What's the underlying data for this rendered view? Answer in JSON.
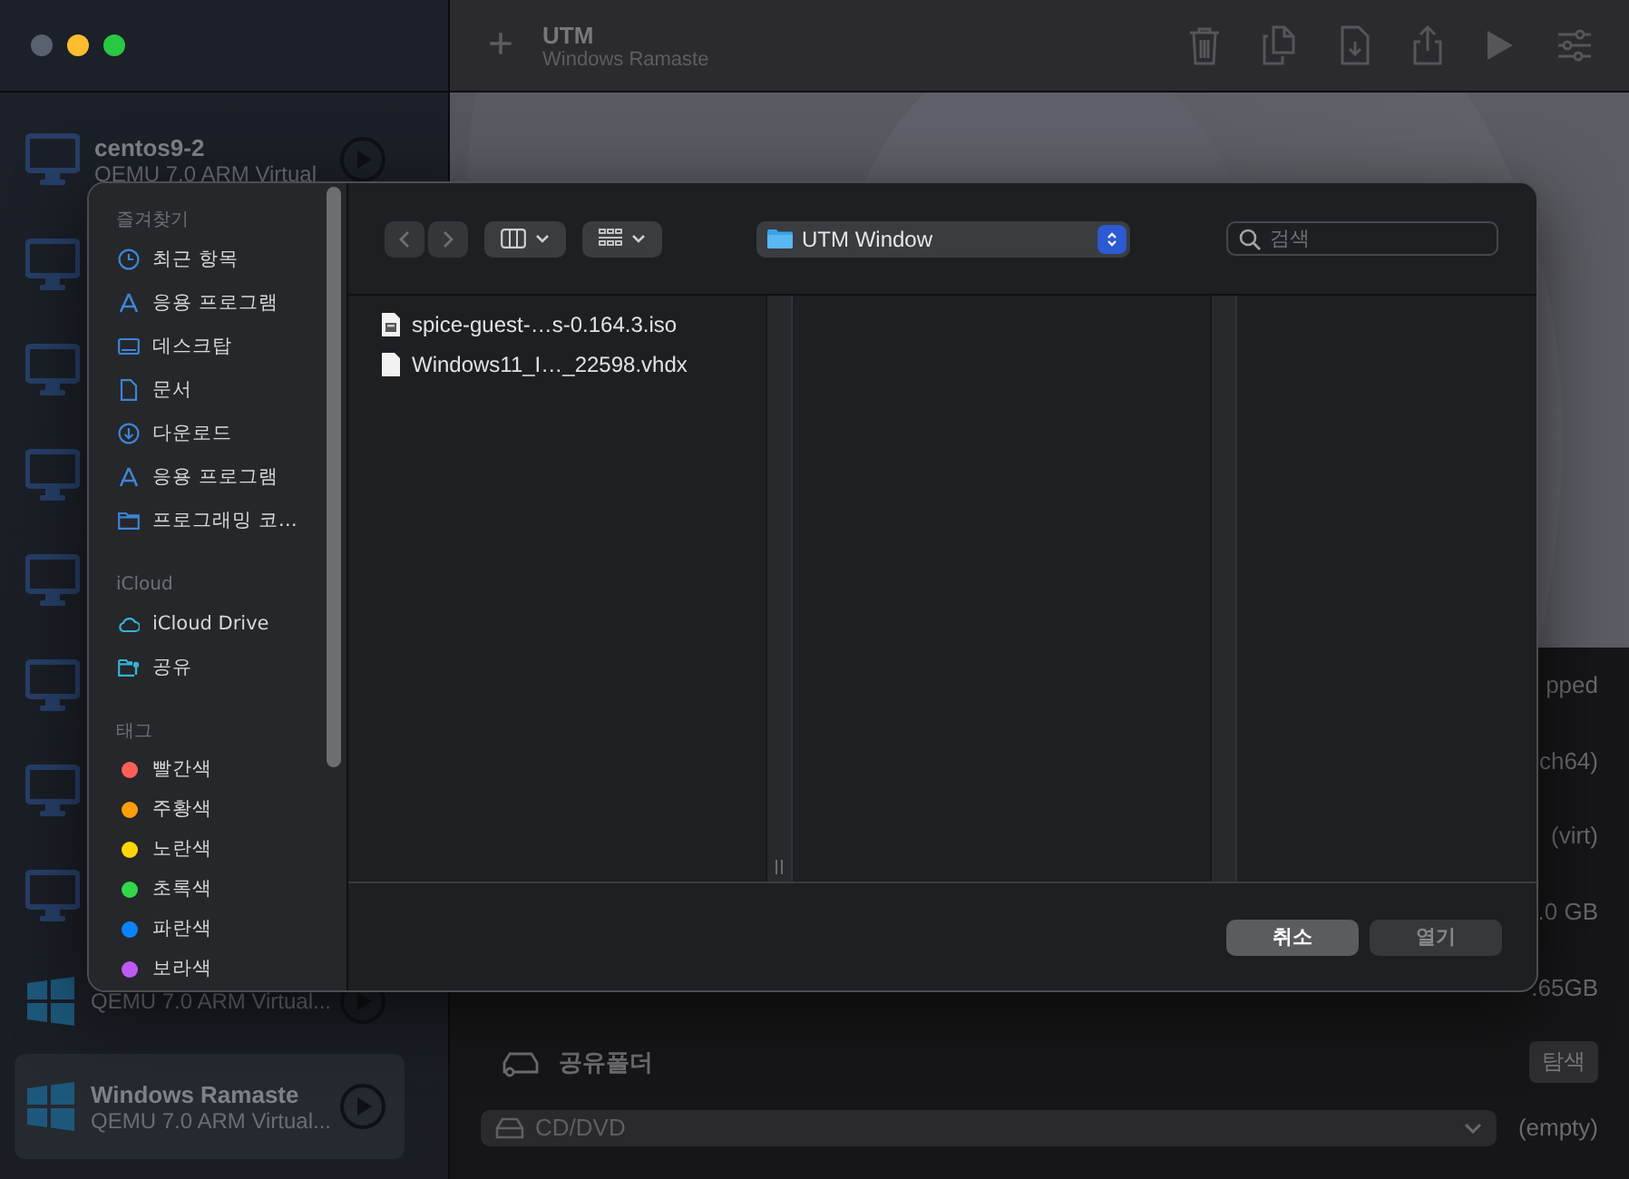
{
  "sidebar": {
    "vms": [
      {
        "name": "centos9-2",
        "subtitle": "QEMU 7.0 ARM Virtual",
        "kind": "monitor",
        "selected": false
      },
      {
        "kind": "monitor",
        "selected": false
      },
      {
        "kind": "monitor",
        "selected": false
      },
      {
        "kind": "monitor",
        "selected": false
      },
      {
        "kind": "monitor",
        "selected": false
      },
      {
        "kind": "monitor",
        "selected": false
      },
      {
        "kind": "monitor",
        "selected": false
      },
      {
        "kind": "monitor",
        "selected": false
      },
      {
        "subtitle": "QEMU 7.0 ARM Virtual...",
        "kind": "windows",
        "selected": false
      },
      {
        "name": "Windows Ramaste",
        "subtitle": "QEMU 7.0 ARM Virtual...",
        "kind": "windows",
        "selected": true
      }
    ]
  },
  "toolbar": {
    "add": "+",
    "title": "UTM",
    "subtitle": "Windows Ramaste"
  },
  "details": {
    "values": [
      "pped",
      "ch64)",
      "(virt)",
      ".0 GB",
      ".65GB"
    ],
    "shared_folder": {
      "label": "공유폴더",
      "button": "탐색"
    },
    "drive": {
      "value": "CD/DVD",
      "status": "(empty)"
    }
  },
  "dialog": {
    "sidebar": [
      {
        "title": "즐겨찾기",
        "items": [
          {
            "label": "최근 항목",
            "kind": "clock"
          },
          {
            "label": "응용 프로그램",
            "kind": "apps"
          },
          {
            "label": "데스크탑",
            "kind": "desktop"
          },
          {
            "label": "문서",
            "kind": "document"
          },
          {
            "label": "다운로드",
            "kind": "download"
          },
          {
            "label": "응용 프로그램",
            "kind": "apps"
          },
          {
            "label": "프로그래밍 코…",
            "kind": "folder"
          }
        ]
      },
      {
        "title": "iCloud",
        "items": [
          {
            "label": "iCloud Drive",
            "kind": "cloud"
          },
          {
            "label": "공유",
            "kind": "shared"
          }
        ]
      },
      {
        "title": "태그",
        "items": [
          {
            "label": "빨간색",
            "kind": "tag",
            "color": "#ff5f57"
          },
          {
            "label": "주황색",
            "kind": "tag",
            "color": "#ff9f0a"
          },
          {
            "label": "노란색",
            "kind": "tag",
            "color": "#ffd60a"
          },
          {
            "label": "초록색",
            "kind": "tag",
            "color": "#32d74b"
          },
          {
            "label": "파란색",
            "kind": "tag",
            "color": "#0a84ff"
          },
          {
            "label": "보라색",
            "kind": "tag",
            "color": "#bf5af2"
          }
        ]
      }
    ],
    "location": "UTM Window",
    "search": {
      "placeholder": "검색"
    },
    "files": [
      {
        "name": "spice-guest-…s-0.164.3.iso",
        "kind": "disk-image"
      },
      {
        "name": "Windows11_I…_22598.vhdx",
        "kind": "document"
      }
    ],
    "buttons": [
      {
        "label": "취소",
        "disabled": false
      },
      {
        "label": "열기",
        "disabled": true
      }
    ]
  }
}
